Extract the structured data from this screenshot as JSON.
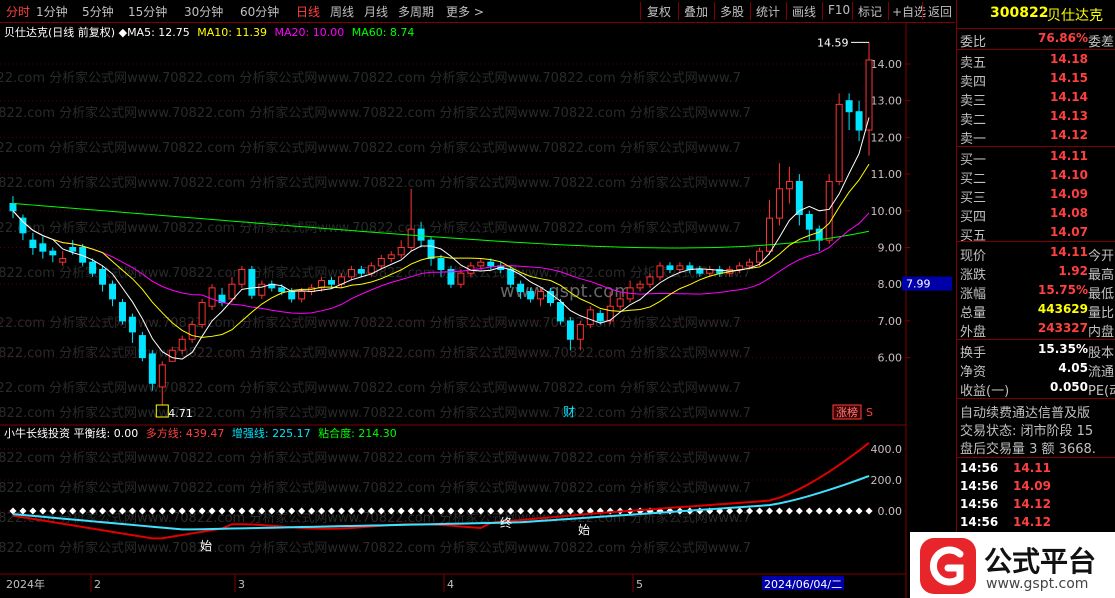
{
  "toolbar": {
    "periods": [
      "分时",
      "1分钟",
      "5分钟",
      "15分钟",
      "30分钟",
      "60分钟",
      "日线",
      "周线",
      "月线",
      "多周期",
      "更多 >"
    ],
    "active_period": "日线",
    "tools": [
      "复权",
      "叠加",
      "多股",
      "统计",
      "画线",
      "F10",
      "标记",
      "+自选",
      "返回"
    ]
  },
  "info": {
    "stock_name": "贝仕达克",
    "mode": "(日线 前复权)",
    "ma5": "MA5: 12.75",
    "ma10": "MA10: 11.39",
    "ma20": "MA20: 10.00",
    "ma60": "MA60: 8.74"
  },
  "main_chart": {
    "price_axis": [
      "14.00",
      "13.00",
      "12.00",
      "11.00",
      "10.00",
      "9.00",
      "8.00",
      "7.00",
      "6.00"
    ],
    "current_price_tag": "7.99",
    "high_label": "14.59",
    "low_label": "4.71",
    "marker_cai": "财",
    "marker_zhangbang": "涨榜",
    "marker_s": "S",
    "watermark_text": "0822.com 分析家公式网www.70822.com 分析家公式网www.70822.com 分析家公式网www.70822.com 分析家公式网www.7",
    "watermark_center": "www.gspt.com"
  },
  "indicator": {
    "name": "小牛长线投资",
    "balance": "平衡线: 0.00",
    "long_short": "多方线: 439.47",
    "enhance": "增强线: 225.17",
    "stick": "粘合度: 214.30",
    "axis": [
      "400.0",
      "200.0",
      "0.00"
    ],
    "label_start": "始",
    "label_end": "终"
  },
  "date_axis": [
    "2024年",
    "2",
    "3",
    "4",
    "5",
    "2024/06/04/二"
  ],
  "quote_panel": {
    "code": "300822",
    "name": "贝仕达克",
    "weibi_label": "委比",
    "weibi_value": "76.86%",
    "weicha_label": "委差",
    "asks": [
      {
        "label": "卖五",
        "price": "14.18"
      },
      {
        "label": "卖四",
        "price": "14.15"
      },
      {
        "label": "卖三",
        "price": "14.14"
      },
      {
        "label": "卖二",
        "price": "14.13"
      },
      {
        "label": "卖一",
        "price": "14.12"
      }
    ],
    "bids": [
      {
        "label": "买一",
        "price": "14.11"
      },
      {
        "label": "买二",
        "price": "14.10"
      },
      {
        "label": "买三",
        "price": "14.09"
      },
      {
        "label": "买四",
        "price": "14.08"
      },
      {
        "label": "买五",
        "price": "14.07"
      }
    ],
    "stats": [
      {
        "label": "现价",
        "value": "14.11",
        "ext": "今开",
        "color": "red"
      },
      {
        "label": "涨跌",
        "value": "1.92",
        "ext": "最高",
        "color": "red"
      },
      {
        "label": "涨幅",
        "value": "15.75%",
        "ext": "最低",
        "color": "red"
      },
      {
        "label": "总量",
        "value": "443629",
        "ext": "量比",
        "color": "yellow"
      },
      {
        "label": "外盘",
        "value": "243327",
        "ext": "内盘",
        "color": "red"
      }
    ],
    "stats2": [
      {
        "label": "换手",
        "value": "15.35%",
        "ext": "股本",
        "color": "white"
      },
      {
        "label": "净资",
        "value": "4.05",
        "ext": "流通",
        "color": "white"
      },
      {
        "label": "收益(一)",
        "value": "0.050",
        "ext": "PE(动",
        "color": "white"
      }
    ],
    "text_lines": [
      "自动续费通达信普及版",
      "交易状态: 闭市阶段 15",
      "盘后交易量 3 额 3668."
    ],
    "ticks": [
      {
        "time": "14:56",
        "price": "14.11"
      },
      {
        "time": "14:56",
        "price": "14.09"
      },
      {
        "time": "14:56",
        "price": "14.12"
      },
      {
        "time": "14:56",
        "price": "14.12"
      }
    ]
  },
  "logo": {
    "title": "公式平台",
    "url": "www.gspt.com"
  },
  "colors": {
    "up": "#ff3232",
    "down": "#00e5ff",
    "ma5": "#ffffff",
    "ma10": "#ffff00",
    "ma20": "#ff00ff",
    "ma60": "#00ff00",
    "border": "#800000"
  }
}
